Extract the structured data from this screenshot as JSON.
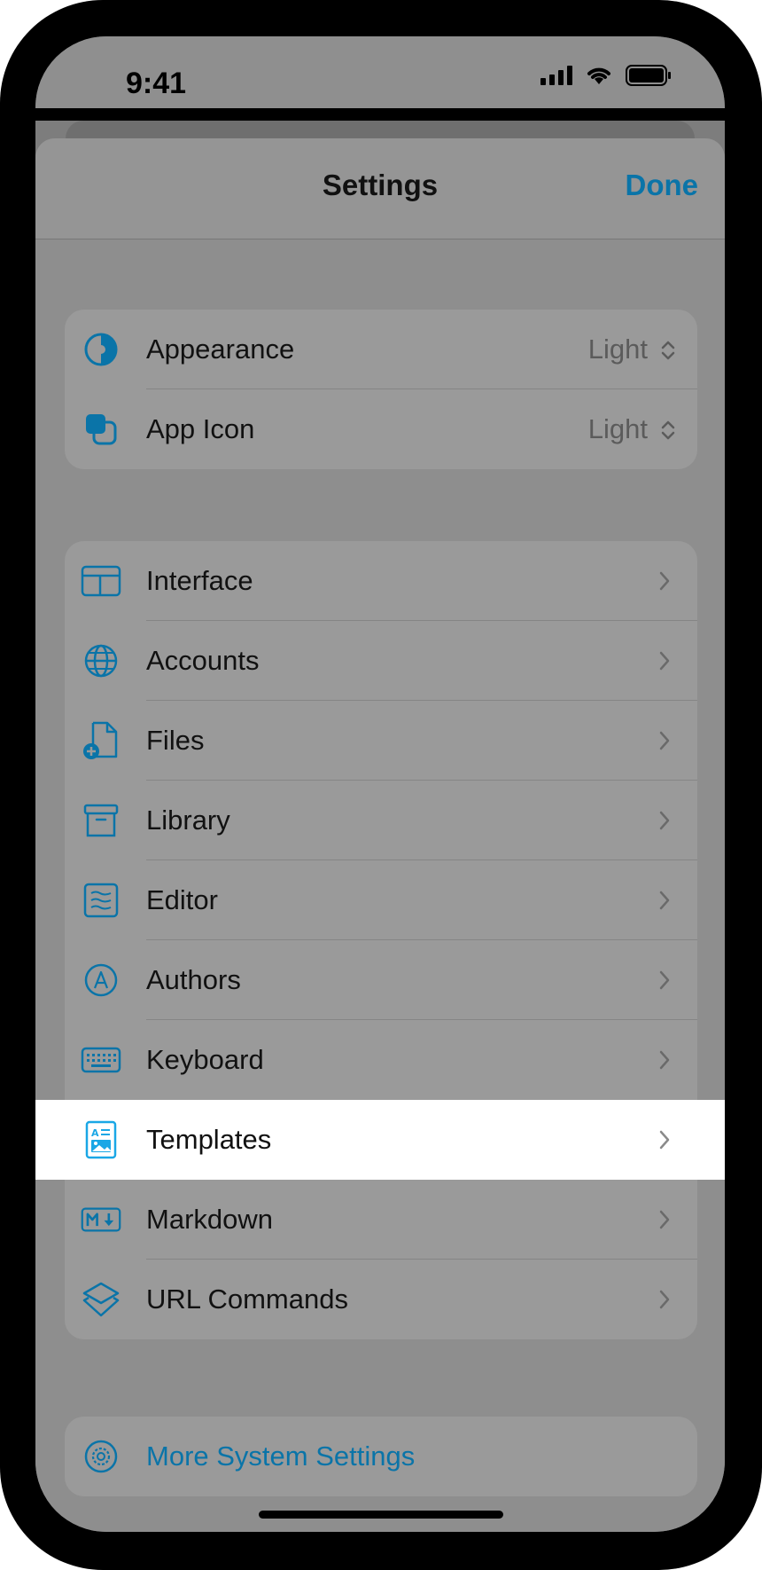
{
  "status_bar": {
    "time": "9:41"
  },
  "nav": {
    "title": "Settings",
    "done_label": "Done"
  },
  "appearance_group": [
    {
      "label": "Appearance",
      "value": "Light",
      "icon": "circle-half-icon"
    },
    {
      "label": "App Icon",
      "value": "Light",
      "icon": "app-icon-squares-icon"
    }
  ],
  "settings_group": [
    {
      "label": "Interface",
      "icon": "layout-icon"
    },
    {
      "label": "Accounts",
      "icon": "globe-icon"
    },
    {
      "label": "Files",
      "icon": "file-add-icon"
    },
    {
      "label": "Library",
      "icon": "archive-box-icon"
    },
    {
      "label": "Editor",
      "icon": "text-lines-icon"
    },
    {
      "label": "Authors",
      "icon": "author-a-icon"
    },
    {
      "label": "Keyboard",
      "icon": "keyboard-icon"
    },
    {
      "label": "Templates",
      "icon": "template-icon"
    },
    {
      "label": "Markdown",
      "icon": "markdown-icon"
    },
    {
      "label": "URL Commands",
      "icon": "layers-icon"
    }
  ],
  "system_group": {
    "label": "More System Settings",
    "icon": "gear-icon"
  },
  "colors": {
    "accent": "#0a74a8",
    "highlight_icon": "#1aa7e6"
  }
}
